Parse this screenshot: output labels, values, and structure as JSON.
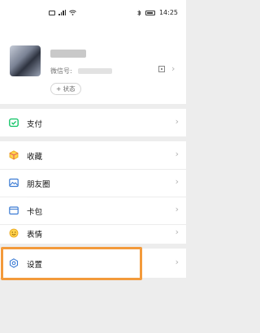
{
  "status_bar": {
    "time": "14:25"
  },
  "profile": {
    "wxid_label": "微信号:",
    "status_button": "+ 状态",
    "chevron": "›"
  },
  "menu": {
    "items": [
      {
        "label": "支付",
        "icon": "pay-icon",
        "chevron": "›"
      },
      {
        "label": "收藏",
        "icon": "favorites-icon",
        "chevron": "›"
      },
      {
        "label": "朋友圈",
        "icon": "moments-icon",
        "chevron": "›"
      },
      {
        "label": "卡包",
        "icon": "card-wallet-icon",
        "chevron": "›"
      },
      {
        "label": "表情",
        "icon": "emoji-icon",
        "chevron": "›"
      },
      {
        "label": "设置",
        "icon": "settings-icon",
        "chevron": "›"
      }
    ]
  },
  "colors": {
    "highlight": "#f39a3b",
    "pay_green": "#07c160"
  }
}
